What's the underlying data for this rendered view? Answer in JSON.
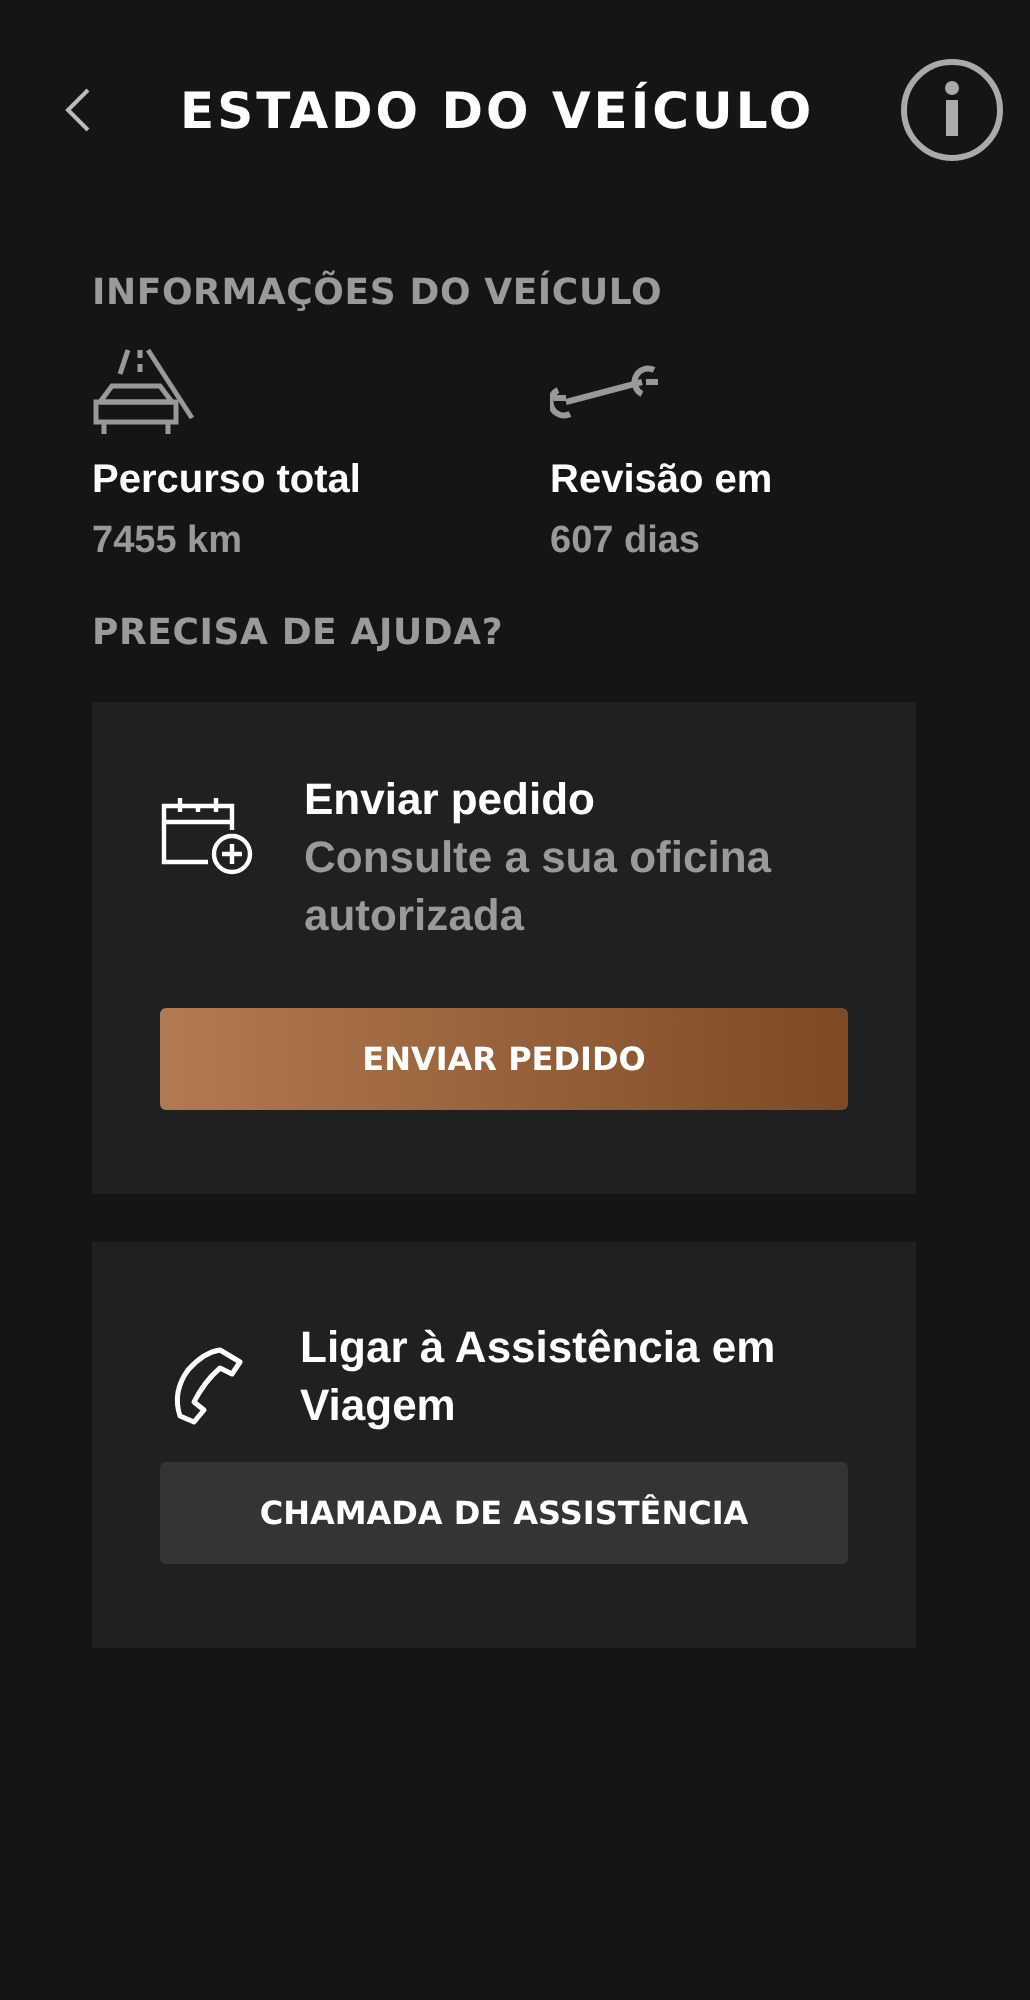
{
  "header": {
    "title": "ESTADO DO VEÍCULO"
  },
  "vehicle_info": {
    "title": "INFORMAÇÕES DO VEÍCULO",
    "items": [
      {
        "kind": "distance",
        "label": "Percurso total",
        "value": "7455 km"
      },
      {
        "kind": "service",
        "label": "Revisão em",
        "value": "607 dias"
      }
    ]
  },
  "help": {
    "title": "PRECISA DE AJUDA?",
    "cards": [
      {
        "kind": "request",
        "title": "Enviar pedido",
        "subtitle": "Consulte a sua oficina autorizada",
        "button": {
          "kind": "primary",
          "label": "ENVIAR PEDIDO"
        }
      },
      {
        "kind": "call",
        "title": "Ligar à Assistência em Viagem",
        "button": {
          "kind": "secondary",
          "label": "CHAMADA DE ASSISTÊNCIA"
        }
      }
    ]
  }
}
